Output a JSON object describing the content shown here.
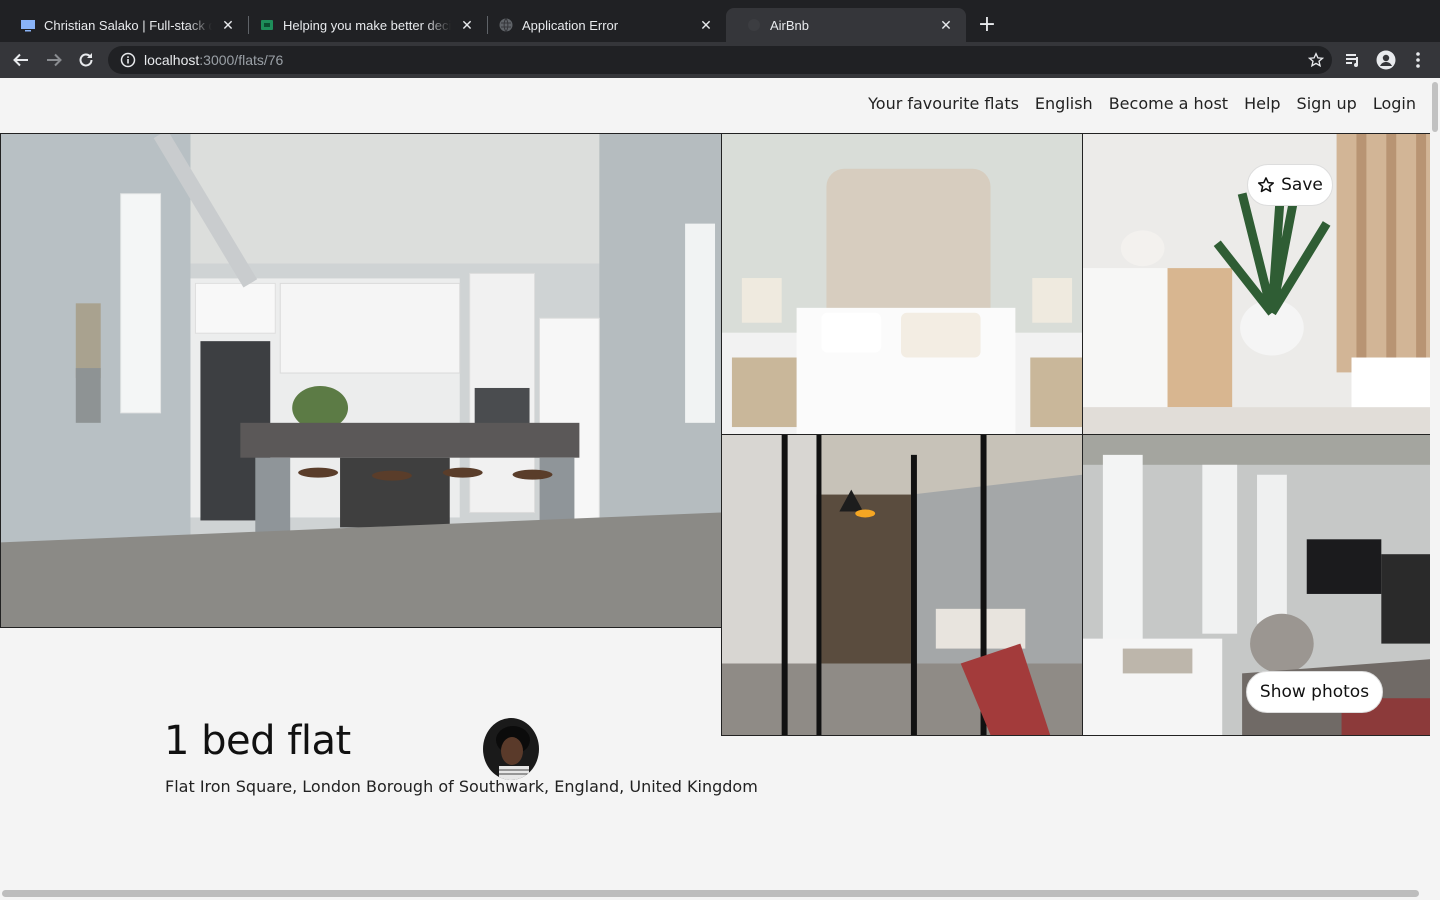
{
  "browser": {
    "tabs": [
      {
        "title": "Christian Salako | Full-stack developer",
        "favicon": "monitor-icon"
      },
      {
        "title": "Helping you make better decisions",
        "favicon": "green-cube-icon"
      },
      {
        "title": "Application Error",
        "favicon": "globe-icon"
      },
      {
        "title": "AirBnb",
        "favicon": "blank-icon",
        "active": true
      }
    ],
    "url_host": "localhost",
    "url_path": ":3000/flats/76"
  },
  "header": {
    "nav": [
      {
        "label": "Your favourite flats"
      },
      {
        "label": "English"
      },
      {
        "label": "Become a host"
      },
      {
        "label": "Help"
      },
      {
        "label": "Sign up"
      },
      {
        "label": "Login"
      }
    ]
  },
  "gallery": {
    "save_label": "Save",
    "show_photos_label": "Show photos"
  },
  "listing": {
    "title": "1 bed flat",
    "address": "Flat Iron Square, London Borough of Southwark, England, United Kingdom"
  },
  "colors": {
    "chrome_dark": "#202124",
    "chrome_toolbar": "#35363a",
    "page_bg": "#f4f4f4"
  }
}
